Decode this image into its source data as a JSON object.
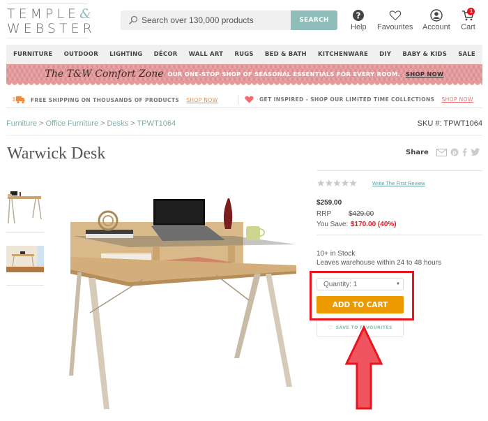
{
  "header": {
    "logo_line1": "TEMPLE",
    "logo_amp": "&",
    "logo_line2": "WEBSTER",
    "search_placeholder": "Search over 130,000 products",
    "search_button": "SEARCH",
    "links": [
      {
        "label": "Help",
        "icon": "help-icon"
      },
      {
        "label": "Favourites",
        "icon": "heart-icon"
      },
      {
        "label": "Account",
        "icon": "account-icon"
      },
      {
        "label": "Cart",
        "icon": "cart-icon",
        "badge": "1"
      }
    ]
  },
  "nav": {
    "items": [
      "FURNITURE",
      "OUTDOOR",
      "LIGHTING",
      "DÉCOR",
      "WALL ART",
      "RUGS",
      "BED & BATH",
      "KITCHENWARE",
      "DIY",
      "BABY & KIDS",
      "SALE"
    ]
  },
  "promo": {
    "script_title": "The T&W Comfort Zone",
    "message": "OUR ONE-STOP SHOP OF SEASONAL ESSENTIALS FOR EVERY ROOM.",
    "link": "SHOP NOW",
    "background_color": "#e8999b"
  },
  "info_strip": [
    {
      "text": "FREE SHIPPING ON THOUSANDS OF PRODUCTS",
      "link": "SHOP NOW",
      "icon": "delivery-truck-icon",
      "accent": "#f28a3c"
    },
    {
      "text": "GET INSPIRED - SHOP OUR LIMITED TIME COLLECTIONS",
      "link": "SHOP NOW",
      "icon": "heart-icon",
      "accent": "#ef6b6f"
    }
  ],
  "breadcrumb": {
    "items": [
      "Furniture",
      "Office Furniture",
      "Desks",
      "TPWT1064"
    ],
    "separator": ">"
  },
  "sku": "SKU #: TPWT1064",
  "product": {
    "title": "Warwick Desk",
    "share_label": "Share",
    "share_icons": [
      "email-icon",
      "pinterest-icon",
      "facebook-icon",
      "twitter-icon"
    ],
    "rating_stars": 0,
    "rating_max": 5,
    "review_link": "Write The First Review",
    "price": "$259.00",
    "rrp_label": "RRP",
    "rrp_value": "$429.00",
    "save_label": "You Save:",
    "save_value": "$170.00 (40%)",
    "stock": "10+ in Stock",
    "dispatch": "Leaves warehouse within 24 to 48 hours",
    "quantity_label": "Quantity: 1",
    "add_to_cart": "ADD TO CART",
    "save_to_favourites": "SAVE TO FAVOURITES",
    "thumbnails": 2
  },
  "annotation": {
    "highlight_color": "#e8141e",
    "arrow_fill": "#f0555f"
  }
}
